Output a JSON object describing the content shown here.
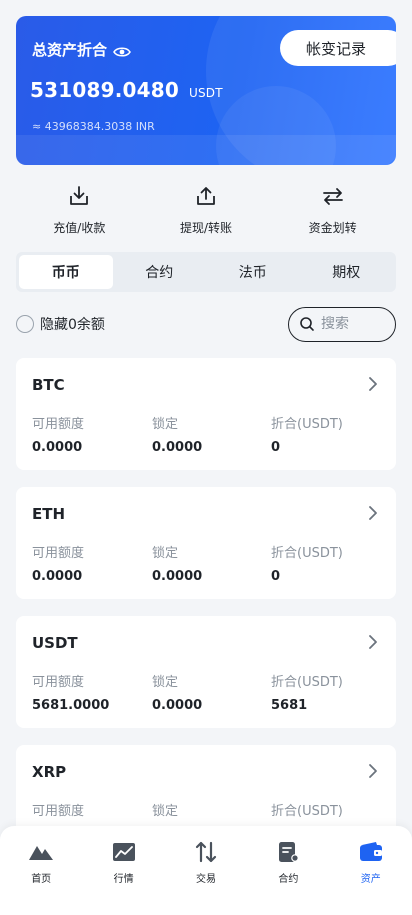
{
  "banner": {
    "title": "总资产折合",
    "history_label": "帐变记录",
    "balance": "531089.0480",
    "unit": "USDT",
    "sub_balance": "≈ 43968384.3038 INR"
  },
  "actions": [
    {
      "label": "充值/收款",
      "icon": "download-icon"
    },
    {
      "label": "提现/转账",
      "icon": "upload-icon"
    },
    {
      "label": "资金划转",
      "icon": "transfer-icon"
    }
  ],
  "tabs": [
    {
      "label": "币币",
      "active": true
    },
    {
      "label": "合约",
      "active": false
    },
    {
      "label": "法币",
      "active": false
    },
    {
      "label": "期权",
      "active": false
    }
  ],
  "filter": {
    "hide_zero_label": "隐藏0余额",
    "search_placeholder": "搜索"
  },
  "assets": [
    {
      "coin": "BTC",
      "available_label": "可用额度",
      "available": "0.0000",
      "locked_label": "锁定",
      "locked": "0.0000",
      "usdt_label": "折合(USDT)",
      "usdt": "0"
    },
    {
      "coin": "ETH",
      "available_label": "可用额度",
      "available": "0.0000",
      "locked_label": "锁定",
      "locked": "0.0000",
      "usdt_label": "折合(USDT)",
      "usdt": "0"
    },
    {
      "coin": "USDT",
      "available_label": "可用额度",
      "available": "5681.0000",
      "locked_label": "锁定",
      "locked": "0.0000",
      "usdt_label": "折合(USDT)",
      "usdt": "5681"
    },
    {
      "coin": "XRP",
      "available_label": "可用额度",
      "available": "",
      "locked_label": "锁定",
      "locked": "",
      "usdt_label": "折合(USDT)",
      "usdt": ""
    }
  ],
  "nav": [
    {
      "label": "首页",
      "icon": "home-icon",
      "active": false
    },
    {
      "label": "行情",
      "icon": "market-icon",
      "active": false
    },
    {
      "label": "交易",
      "icon": "trade-icon",
      "active": false
    },
    {
      "label": "合约",
      "icon": "contract-icon",
      "active": false
    },
    {
      "label": "资产",
      "icon": "wallet-icon",
      "active": true
    }
  ],
  "colors": {
    "accent": "#1e63f2",
    "background": "#f3f5f8",
    "text": "#1f2329",
    "muted": "#8a929c"
  }
}
